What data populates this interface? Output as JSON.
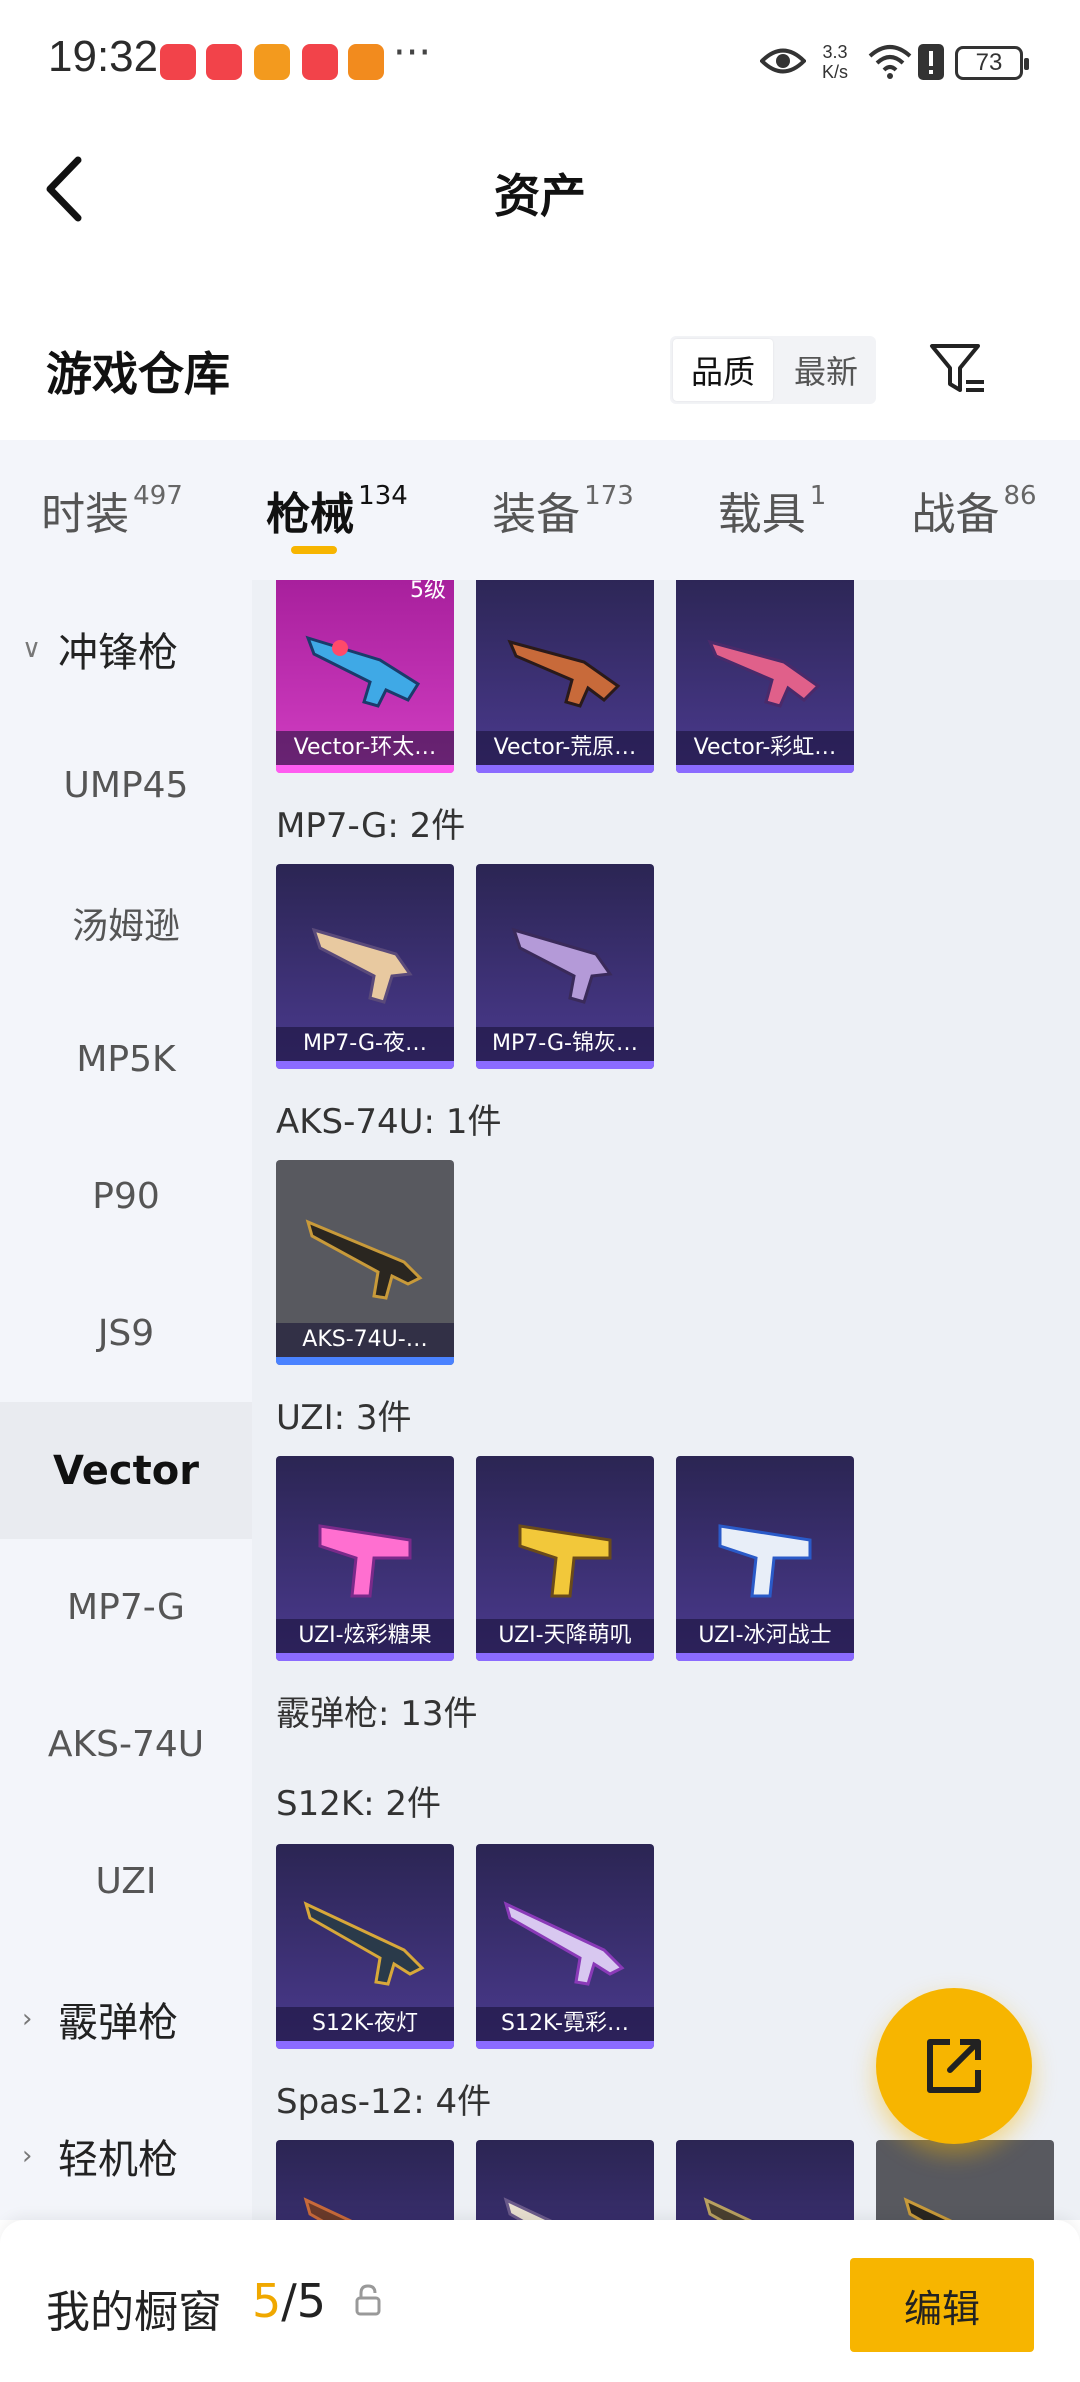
{
  "status_bar": {
    "time": "19:32",
    "more": "···",
    "speed_value": "3.3",
    "speed_unit": "K/s",
    "battery": "73"
  },
  "header": {
    "title": "资产",
    "back_icon": "chevron-left-icon"
  },
  "warehouse": {
    "title": "游戏仓库",
    "sort_options": [
      "品质",
      "最新"
    ],
    "sort_selected": "品质",
    "filter_icon": "filter-icon"
  },
  "tabs": [
    {
      "label": "时装",
      "count": "497"
    },
    {
      "label": "枪械",
      "count": "134",
      "active": true
    },
    {
      "label": "装备",
      "count": "173"
    },
    {
      "label": "载具",
      "count": "1"
    },
    {
      "label": "战备",
      "count": "86"
    }
  ],
  "sidebar": {
    "items": [
      {
        "label": "冲锋枪",
        "type": "group",
        "expanded": true
      },
      {
        "label": "UMP45"
      },
      {
        "label": "汤姆逊"
      },
      {
        "label": "MP5K"
      },
      {
        "label": "P90"
      },
      {
        "label": "JS9"
      },
      {
        "label": "Vector",
        "selected": true
      },
      {
        "label": "MP7-G"
      },
      {
        "label": "AKS-74U"
      },
      {
        "label": "UZI"
      },
      {
        "label": "霰弹枪",
        "type": "group",
        "expanded": false
      },
      {
        "label": "轻机枪",
        "type": "group",
        "expanded": false
      }
    ]
  },
  "content": {
    "vector_items": [
      {
        "name": "Vector-环太…",
        "level": "5级",
        "rarity": "pink"
      },
      {
        "name": "Vector-荒原…",
        "rarity": "purple"
      },
      {
        "name": "Vector-彩虹…",
        "rarity": "purple"
      }
    ],
    "groups": [
      {
        "label": "MP7-G: 2件",
        "items": [
          {
            "name": "MP7-G-夜…",
            "rarity": "purple"
          },
          {
            "name": "MP7-G-锦灰…",
            "rarity": "purple"
          }
        ]
      },
      {
        "label": "AKS-74U: 1件",
        "items": [
          {
            "name": "AKS-74U-…",
            "rarity": "gray"
          }
        ]
      },
      {
        "label": "UZI: 3件",
        "items": [
          {
            "name": "UZI-炫彩糖果",
            "rarity": "purple"
          },
          {
            "name": "UZI-天降萌叽",
            "rarity": "purple"
          },
          {
            "name": "UZI-冰河战士",
            "rarity": "purple"
          }
        ]
      },
      {
        "label": "霰弹枪: 13件"
      },
      {
        "label": "S12K: 2件",
        "items": [
          {
            "name": "S12K-夜灯",
            "rarity": "purple"
          },
          {
            "name": "S12K-霓彩…",
            "rarity": "purple"
          }
        ]
      },
      {
        "label": "Spas-12: 4件"
      }
    ]
  },
  "fab": {
    "icon": "external-link-icon"
  },
  "bottom_bar": {
    "label": "我的橱窗",
    "used": "5",
    "total": "/5",
    "lock_icon": "lock-icon",
    "edit_label": "编辑"
  },
  "colors": {
    "accent": "#f7b500",
    "rarity_purple": "#4b3a8f",
    "rarity_pink": "#d23ec3",
    "rarity_gray": "#58595f"
  }
}
